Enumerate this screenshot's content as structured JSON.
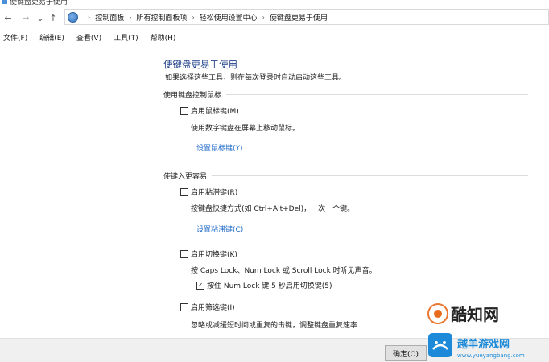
{
  "window": {
    "title": "使键盘更易于使用"
  },
  "nav": {
    "back_icon": "←",
    "forward_icon": "→",
    "recent_icon": "⌄",
    "up_icon": "↑"
  },
  "breadcrumb": {
    "items": [
      "控制面板",
      "所有控制面板项",
      "轻松使用设置中心",
      "使键盘更易于使用"
    ],
    "separator": "›"
  },
  "menu": {
    "items": [
      "文件(F)",
      "编辑(E)",
      "查看(V)",
      "工具(T)",
      "帮助(H)"
    ]
  },
  "main": {
    "title": "使键盘更易于使用",
    "description": "如果选择这些工具，则在每次登录时自动启动这些工具。",
    "section1": {
      "label": "使用键盘控制鼠标",
      "mouse_keys": {
        "label": "启用鼠标键(M)",
        "checked": false,
        "description": "使用数字键盘在屏幕上移动鼠标。",
        "link": "设置鼠标键(Y)"
      }
    },
    "section2": {
      "label": "使键入更容易",
      "sticky_keys": {
        "label": "启用粘滞键(R)",
        "checked": false,
        "description": "按键盘快捷方式(如 Ctrl+Alt+Del)，一次一个键。",
        "link": "设置粘滞键(C)"
      },
      "toggle_keys": {
        "label": "启用切换键(K)",
        "checked": false,
        "description": "按 Caps Lock、Num Lock 或 Scroll Lock 时听见声音。",
        "sub_option": {
          "label": "按住 Num Lock 键 5 秒启用切换键(5)",
          "checked": true
        }
      },
      "filter_keys": {
        "label": "启用筛选键(I)",
        "checked": false,
        "description": "忽略或减缓短时间或重复的击键，调整键盘重复速率"
      }
    }
  },
  "footer": {
    "ok_button": "确定(O)"
  },
  "watermark": {
    "brand": "酷知网",
    "site_cn": "越羊游戏网",
    "site_url": "www.yueyangbang.com",
    "brand_color": "#e86a1c",
    "accent_color": "#1c8ad8"
  },
  "colors": {
    "title": "#1e3f8a",
    "link": "#1d68c7"
  }
}
